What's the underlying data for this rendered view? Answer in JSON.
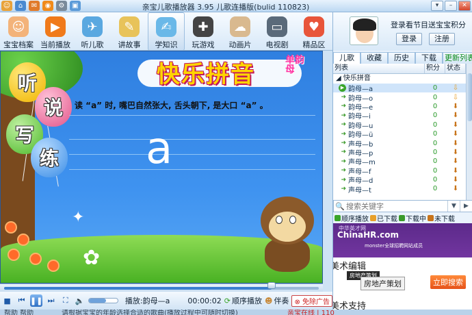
{
  "app": {
    "title": "亲宝儿歌播放器 3.95 儿歌连播版(bulid 110823)"
  },
  "toolbar": {
    "items": [
      {
        "label": "宝宝档案",
        "icon": "baby-face-icon",
        "color": "#f3b37a"
      },
      {
        "label": "当前播放",
        "icon": "play-icon",
        "color": "#f07a1a"
      },
      {
        "label": "听儿歌",
        "icon": "bird-icon",
        "color": "#5aa8e0"
      },
      {
        "label": "讲故事",
        "icon": "book-icon",
        "color": "#e8c35a"
      },
      {
        "label": "学知识",
        "icon": "open-book-icon",
        "color": "#6ab8e8"
      },
      {
        "label": "玩游戏",
        "icon": "gamepad-icon",
        "color": "#444444"
      },
      {
        "label": "动画片",
        "icon": "sheep-icon",
        "color": "#d9b98f"
      },
      {
        "label": "电视剧",
        "icon": "tv-icon",
        "color": "#5a6a7a"
      },
      {
        "label": "精品区",
        "icon": "heart-icon",
        "color": "#e8553a"
      }
    ],
    "active_index": 4
  },
  "stage": {
    "balloons": [
      "听",
      "说",
      "写",
      "练"
    ],
    "title": "快乐拼音",
    "subtitle": "单韵母",
    "instruction": "读 “a” 时, 嘴巴自然张大, 舌头朝下, 是大口 “a” 。",
    "letter": "a"
  },
  "player": {
    "progress": 0.85,
    "volume": 0.6,
    "now_playing": "播放:韵母—a",
    "time": "00:00:02",
    "mode": "顺序播放",
    "accompany": "伴奏",
    "ad_free": "免除广告"
  },
  "user": {
    "tip": "登录看节目送宝宝积分",
    "login": "登录",
    "register": "注册"
  },
  "tabs": [
    "儿歌",
    "收藏",
    "历史",
    "下载",
    "更新列表"
  ],
  "list": {
    "headers": [
      "列表",
      "积分",
      "状态"
    ],
    "group": "快乐拼音",
    "rows": [
      {
        "name": "韵母—a",
        "score": "0",
        "selected": true,
        "playing": true
      },
      {
        "name": "韵母—o",
        "score": "0"
      },
      {
        "name": "韵母—e",
        "score": "0"
      },
      {
        "name": "韵母—i",
        "score": "0"
      },
      {
        "name": "韵母—u",
        "score": "0"
      },
      {
        "name": "韵母—ü",
        "score": "0"
      },
      {
        "name": "声母—b",
        "score": "0"
      },
      {
        "name": "声母—p",
        "score": "0"
      },
      {
        "name": "声母—m",
        "score": "0"
      },
      {
        "name": "声母—f",
        "score": "0"
      },
      {
        "name": "声母—d",
        "score": "0"
      },
      {
        "name": "声母—t",
        "score": "0"
      }
    ]
  },
  "search": {
    "placeholder": "搜索关键字"
  },
  "legend": {
    "items": [
      {
        "label": "顺序播放",
        "color": "#3aa52a"
      },
      {
        "label": "已下载",
        "color": "#e8a02a"
      },
      {
        "label": "下载中",
        "color": "#3a9a2a"
      },
      {
        "label": "未下载",
        "color": "#c8741a"
      }
    ]
  },
  "ad": {
    "brand_small": "中华英才网",
    "brand": "ChinaHR.com",
    "monster": "monster全球招聘网站成员",
    "heading1": "美术编辑",
    "tag1": "房地产策划",
    "tag2": "房地产策划",
    "cta": "立即搜索",
    "heading2": "美术支持"
  },
  "statusbar": {
    "left": "帮助 帮助",
    "middle": "请根据宝宝的年龄选择合适的歌曲(播放过程中可随时切换)",
    "right": "亲宝在线 | 110"
  }
}
